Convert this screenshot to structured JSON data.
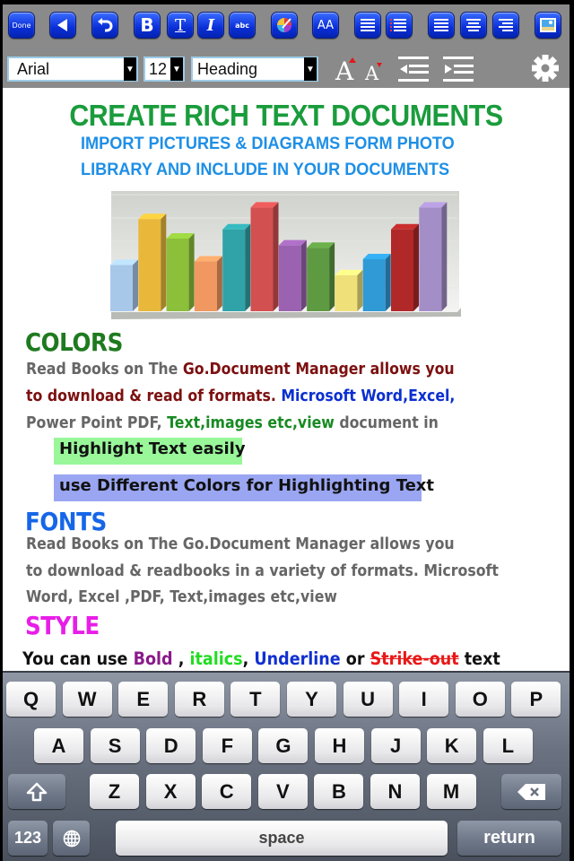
{
  "toolbar": {
    "row1": [
      {
        "id": "done",
        "label": "Done",
        "icon": "done-button"
      },
      {
        "id": "back",
        "label": "",
        "icon": "back-arrow-icon"
      },
      {
        "id": "undo",
        "label": "",
        "icon": "undo-icon"
      },
      {
        "id": "bold",
        "label": "B",
        "icon": "bold-icon"
      },
      {
        "id": "underline",
        "label": "T",
        "icon": "underline-icon"
      },
      {
        "id": "italic",
        "label": "I",
        "icon": "italic-icon"
      },
      {
        "id": "strike",
        "label": "abc",
        "icon": "strikethrough-icon"
      },
      {
        "id": "color",
        "label": "",
        "icon": "color-palette-icon"
      },
      {
        "id": "fontsize",
        "label": "AA",
        "icon": "font-size-icon"
      },
      {
        "id": "bullets",
        "label": "",
        "icon": "bullet-list-icon"
      },
      {
        "id": "numbers",
        "label": "",
        "icon": "numbered-list-icon"
      },
      {
        "id": "align-left",
        "label": "",
        "icon": "align-left-icon"
      },
      {
        "id": "align-center",
        "label": "",
        "icon": "align-center-icon"
      },
      {
        "id": "align-right",
        "label": "",
        "icon": "align-right-icon"
      },
      {
        "id": "insert-image",
        "label": "",
        "icon": "photo-icon"
      }
    ],
    "font_family": "Arial",
    "font_size": "12",
    "paragraph_style": "Heading",
    "dropdown_arrow": "▼"
  },
  "document": {
    "title": "CREATE RICH TEXT DOCUMENTS",
    "subtitle_1": "IMPORT PICTURES & DIAGRAMS FORM PHOTO",
    "subtitle_2": "LIBRARY AND INCLUDE IN YOUR DOCUMENTS",
    "image": {
      "description": "3D bar chart picture",
      "bar_colors": [
        "#a8c8ea",
        "#e9b83a",
        "#8cbf3a",
        "#f09860",
        "#2fa3a8",
        "#d25050",
        "#9a62b0",
        "#5e9a42",
        "#efe07a",
        "#2f9ad6",
        "#b02828",
        "#a48ec8"
      ],
      "relative_heights": [
        0.45,
        0.85,
        0.68,
        0.48,
        0.76,
        0.95,
        0.62,
        0.6,
        0.36,
        0.5,
        0.76,
        0.95
      ]
    },
    "colors_section": {
      "heading": "COLORS",
      "line1_a": "Read Books on The ",
      "line1_b": "Go.Document Manager allows you",
      "line2_a": "to download & read of formats.  ",
      "line2_b": "Microsoft Word,Excel,",
      "line3_a": "Power Point PDF, ",
      "line3_b": "Text,images etc,view",
      "line3_c": " document in",
      "highlight_1": "Highlight Text easily",
      "highlight_2": "use Different  Colors for Highlighting Text"
    },
    "fonts_section": {
      "heading": "FONTS",
      "line1": "Read Books on The Go.Document Manager allows you",
      "line2": "to download & readbooks in a variety of formats. Microsoft",
      "line3": "Word, Excel ,PDF, Text,images etc,view"
    },
    "style_section": {
      "heading": "STYLE",
      "prefix": "You can use ",
      "bold": "Bold",
      "sep1": " , ",
      "italics": "italics",
      "sep2": ", ",
      "underline": "Underline",
      "or": " or ",
      "strike": "Strike-out",
      "suffix": " text"
    },
    "colors": {
      "title_green": "#1a9c3c",
      "subtitle_blue": "#1e8fe6",
      "colors_heading": "#1f7a1f",
      "fonts_heading": "#1666e8",
      "style_heading": "#e81ee8",
      "highlight_green": "#99f79a",
      "highlight_blue": "#9aa6f2"
    }
  },
  "keyboard": {
    "row1": [
      "Q",
      "W",
      "E",
      "R",
      "T",
      "Y",
      "U",
      "I",
      "O",
      "P"
    ],
    "row2": [
      "A",
      "S",
      "D",
      "F",
      "G",
      "H",
      "J",
      "K",
      "L"
    ],
    "row3": [
      "Z",
      "X",
      "C",
      "V",
      "B",
      "N",
      "M"
    ],
    "numbers_key": "123",
    "space_key": "space",
    "return_key": "return"
  }
}
